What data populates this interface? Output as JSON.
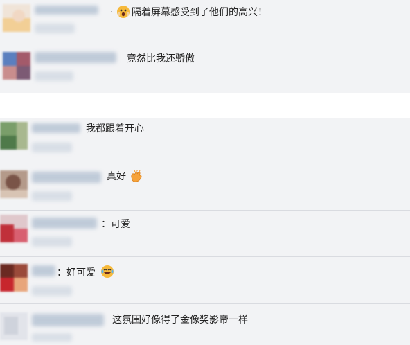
{
  "comments": [
    {
      "text": "·",
      "text2": "隔着屏幕感受到了他们的高兴！",
      "emoji": "scream-emoji"
    },
    {
      "text": "竟然比我还骄傲"
    },
    {
      "text": "我都跟着开心"
    },
    {
      "text": "真好",
      "emoji": "clapping-hands-emoji"
    },
    {
      "text": "：可爱"
    },
    {
      "text": "：好可爱",
      "emoji": "laughing-tears-emoji"
    },
    {
      "text": "这氛围好像得了金像奖影帝一样"
    }
  ],
  "colors": {
    "block_background": "#f2f3f5",
    "divider": "#d9dbe0",
    "text": "#222222",
    "emoji_yellow": "#f6b93b"
  }
}
